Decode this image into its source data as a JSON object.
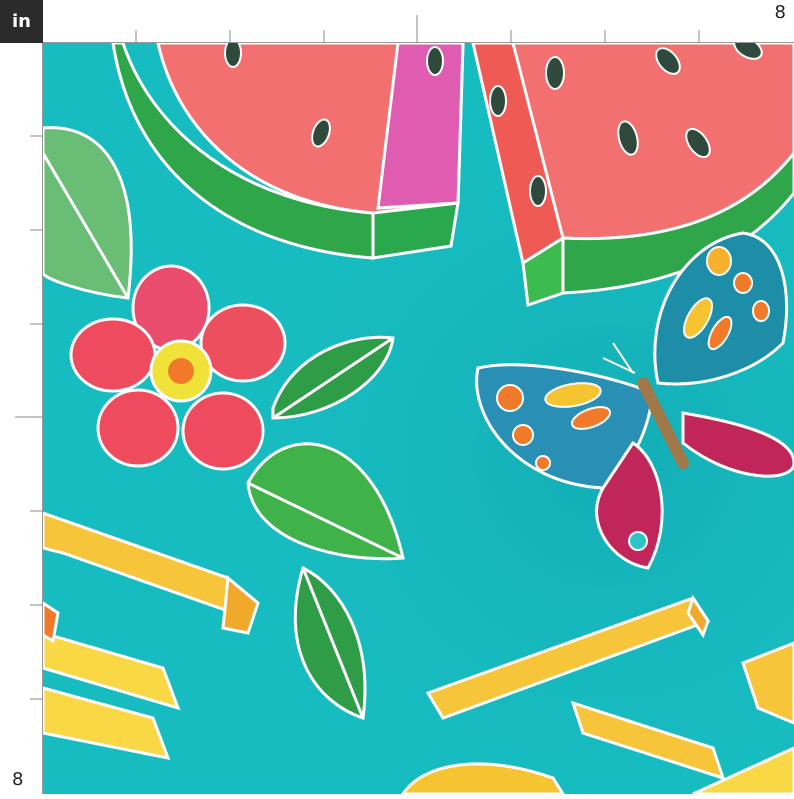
{
  "ruler": {
    "unit_label": "in",
    "top_end_label": "8",
    "left_end_label": "8"
  },
  "fabric": {
    "background_color": "#17bcc0",
    "motifs": [
      "watermelon-slice",
      "watermelon-slice",
      "flower",
      "leaf",
      "leaf",
      "leaf",
      "leaf",
      "leaf",
      "butterfly",
      "french-fries"
    ]
  }
}
